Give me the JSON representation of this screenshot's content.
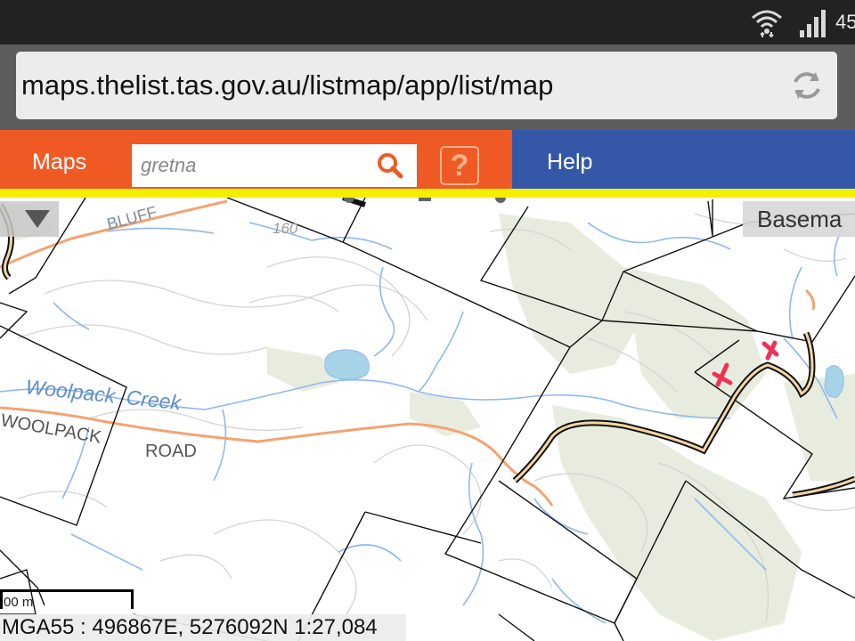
{
  "status_bar": {
    "battery_text": "45",
    "wifi_icon": "wifi-icon",
    "signal_icon": "cell-signal-icon"
  },
  "browser": {
    "url": "maps.thelist.tas.gov.au/listmap/app/list/map",
    "reload_icon": "reload-icon"
  },
  "toolbar": {
    "maps_label": "Maps",
    "search_value": "gretna",
    "search_icon": "search-icon",
    "help_icon_label": "?",
    "help_label": "Help",
    "colors": {
      "orange": "#ef5a24",
      "blue": "#3557a8",
      "yellow": "#f2f000"
    }
  },
  "map": {
    "basemap_label": "Basema",
    "layer_dropdown_icon": "triangle-down-icon",
    "labels": {
      "bluff": "BLUFF",
      "contour_160": "160",
      "creek": "Woolpack  Creek",
      "woolpack_road_1": "WOOLPACK",
      "woolpack_road_2": "ROAD"
    },
    "markers": [
      "x-marker",
      "x-marker"
    ],
    "marker_color": "#ee3355",
    "scale_label": "00 m",
    "coord_readout": "MGA55 : 496867E, 5276092N 1:27,084"
  }
}
